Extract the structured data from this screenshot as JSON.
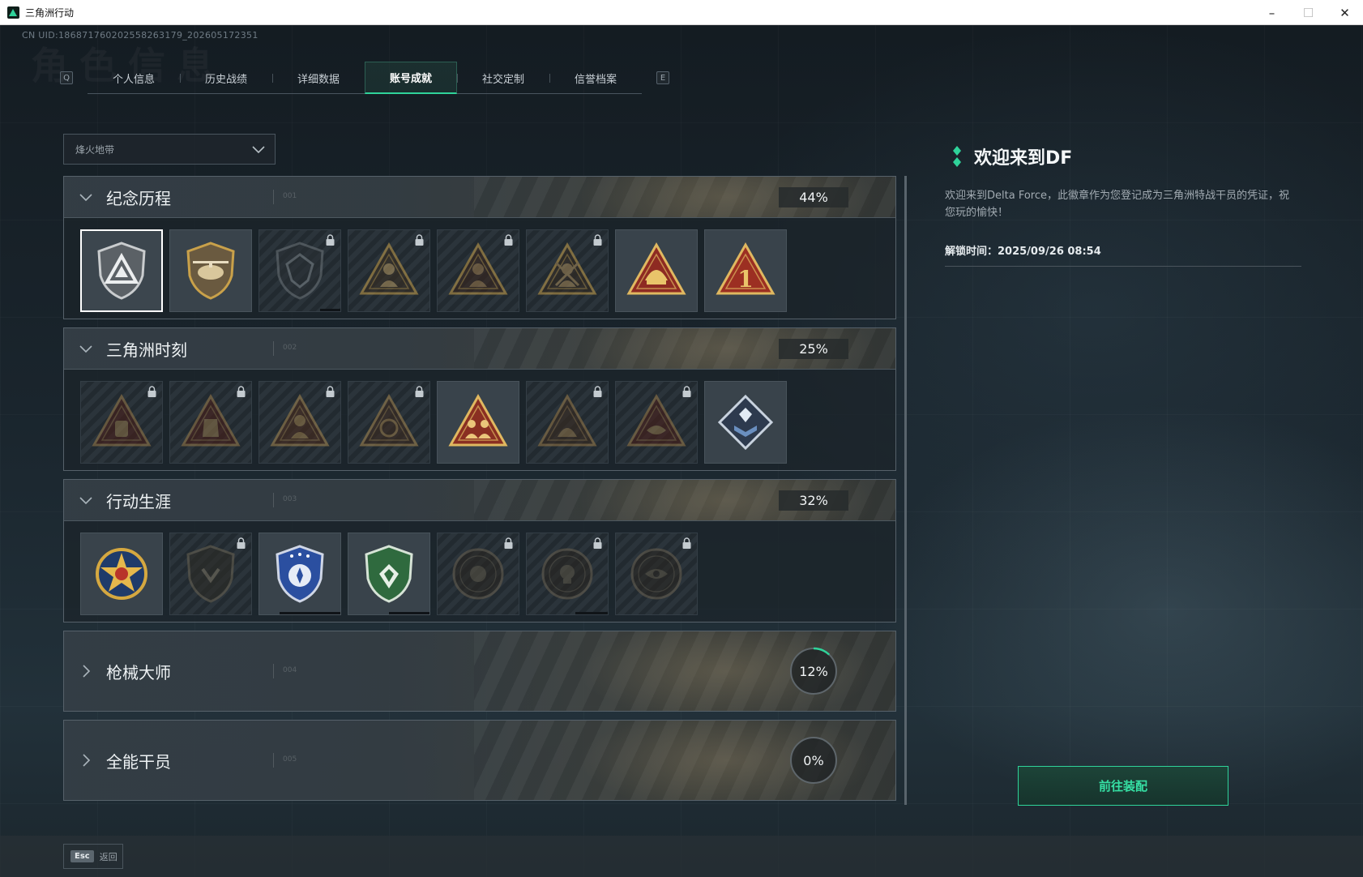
{
  "window": {
    "title": "三角洲行动",
    "controls": [
      "–",
      "☐",
      "✕"
    ]
  },
  "uid": "CN UID:186871760202558263179_202605172351",
  "watermark": "角色信息",
  "tabs": {
    "left_key": "Q",
    "right_key": "E",
    "items": [
      "个人信息",
      "历史战绩",
      "详细数据",
      "账号成就",
      "社交定制",
      "信誉档案"
    ],
    "active_index": 3
  },
  "filter": {
    "selected": "烽火地带",
    "icon": "chevron-down-icon"
  },
  "sections": [
    {
      "title": "纪念历程",
      "number": "001",
      "percent": "44%",
      "expanded": true,
      "badges": [
        {
          "icon": "delta-emblem-icon",
          "locked": false,
          "selected": true
        },
        {
          "icon": "helicopter-emblem-icon",
          "locked": false
        },
        {
          "icon": "shield-emblem-icon",
          "locked": true,
          "progress": 0.25
        },
        {
          "icon": "soldier-emblem-icon",
          "locked": true
        },
        {
          "icon": "hooded-figure-emblem-icon",
          "locked": true
        },
        {
          "icon": "crossed-swords-emblem-icon",
          "locked": true
        },
        {
          "icon": "golden-helmet-emblem-icon",
          "locked": false
        },
        {
          "icon": "number-one-emblem-icon",
          "locked": false
        }
      ]
    },
    {
      "title": "三角洲时刻",
      "number": "002",
      "percent": "25%",
      "expanded": true,
      "badges": [
        {
          "icon": "backpack-emblem-icon",
          "locked": true
        },
        {
          "icon": "vest-emblem-icon",
          "locked": true
        },
        {
          "icon": "operator-emblem-icon",
          "locked": true
        },
        {
          "icon": "globe-emblem-icon",
          "locked": true
        },
        {
          "icon": "squad-emblem-icon",
          "locked": false
        },
        {
          "icon": "beast-emblem-icon",
          "locked": true
        },
        {
          "icon": "fish-emblem-icon",
          "locked": true
        },
        {
          "icon": "crystal-book-emblem-icon",
          "locked": false
        }
      ]
    },
    {
      "title": "行动生涯",
      "number": "003",
      "percent": "32%",
      "expanded": true,
      "badges": [
        {
          "icon": "star-medal-icon",
          "locked": false
        },
        {
          "icon": "dark-shield-emblem-icon",
          "locked": true
        },
        {
          "icon": "blue-police-badge-icon",
          "locked": false,
          "progress": 0.75
        },
        {
          "icon": "green-badge-icon",
          "locked": false,
          "progress": 0.5
        },
        {
          "icon": "shell-medal-icon",
          "locked": true
        },
        {
          "icon": "skull-medal-icon",
          "locked": true,
          "progress": 0.4
        },
        {
          "icon": "eye-medal-icon",
          "locked": true
        }
      ]
    },
    {
      "title": "枪械大师",
      "number": "004",
      "percent": "12%",
      "progress": 0.12,
      "expanded": false
    },
    {
      "title": "全能干员",
      "number": "005",
      "percent": "0%",
      "progress": 0,
      "expanded": false
    }
  ],
  "detail": {
    "title": "欢迎来到DF",
    "description": "欢迎来到Delta Force，此徽章作为您登记成为三角洲特战干员的凭证，祝您玩的愉快！",
    "unlock_time": "解锁时间：2025/09/26 08:54",
    "equip_button": "前往装配"
  },
  "footer": {
    "key": "Esc",
    "label": "返回"
  },
  "colors": {
    "accent": "#2fd39a",
    "accent_text": "#36e0a4",
    "gold": "#c9a14a",
    "red": "#8e2a22"
  }
}
